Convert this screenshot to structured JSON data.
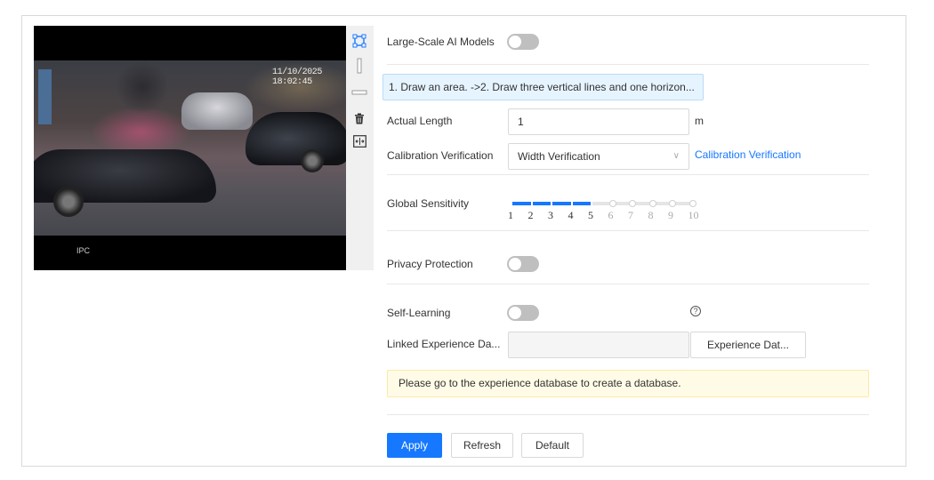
{
  "video": {
    "osd_timestamp": "11/10/2025 18:02:45",
    "osd_channel": "IPC"
  },
  "tools": [
    {
      "name": "draw-area-icon"
    },
    {
      "name": "vertical-line-icon"
    },
    {
      "name": "horizontal-line-icon"
    },
    {
      "name": "delete-icon"
    },
    {
      "name": "fit-width-icon"
    }
  ],
  "settings": {
    "large_scale_ai_models": {
      "label": "Large-Scale AI Models",
      "enabled": false
    },
    "hint": "1. Draw an area. ->2. Draw three vertical lines and one horizon...",
    "actual_length": {
      "label": "Actual Length",
      "value": "1",
      "unit": "m"
    },
    "calibration_verification": {
      "label": "Calibration Verification",
      "selected": "Width Verification",
      "link": "Calibration Verification"
    },
    "global_sensitivity": {
      "label": "Global Sensitivity",
      "value": 5,
      "ticks": [
        "1",
        "2",
        "3",
        "4",
        "5",
        "6",
        "7",
        "8",
        "9",
        "10"
      ]
    },
    "privacy_protection": {
      "label": "Privacy Protection",
      "enabled": false
    },
    "self_learning": {
      "label": "Self-Learning",
      "enabled": false,
      "help_icon": "question-circle-icon"
    },
    "linked_experience_db": {
      "label": "Linked Experience Da...",
      "value": "",
      "button": "Experience Dat..."
    },
    "notice": "Please go to the experience database to create a database."
  },
  "actions": {
    "apply": "Apply",
    "refresh": "Refresh",
    "default": "Default"
  },
  "colors": {
    "primary": "#1677ff",
    "toggle_off": "#bfbfbf",
    "hint_bg": "#e6f4ff",
    "notice_bg": "#fffbe6"
  }
}
